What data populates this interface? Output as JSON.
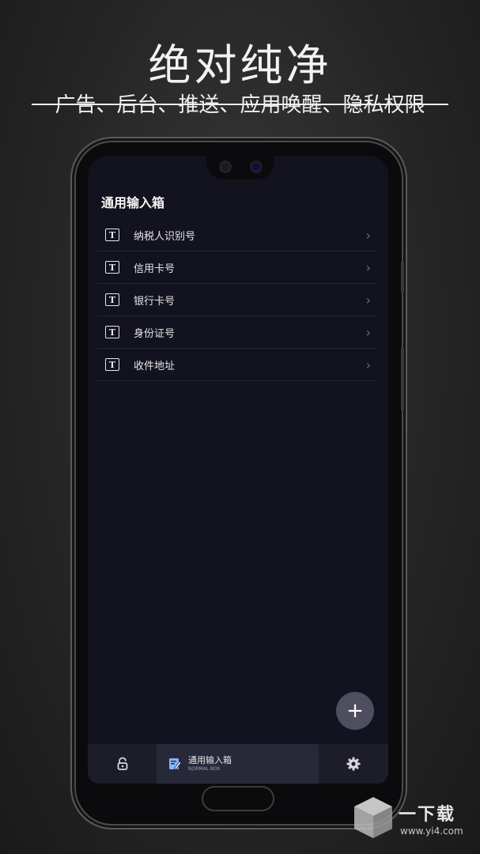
{
  "headline": "绝对纯净",
  "subline": "广告、后台、推送、应用唤醒、隐私权限",
  "screen": {
    "title": "通用输入箱",
    "items": [
      {
        "label": "纳税人识别号",
        "icon": "text-type-icon"
      },
      {
        "label": "信用卡号",
        "icon": "text-type-icon"
      },
      {
        "label": "银行卡号",
        "icon": "text-type-icon"
      },
      {
        "label": "身份证号",
        "icon": "text-type-icon"
      },
      {
        "label": "收件地址",
        "icon": "text-type-icon"
      }
    ],
    "fab_label": "+",
    "nav": {
      "left_icon": "lock-icon",
      "mid_title": "通用输入箱",
      "mid_subtitle": "NORMAL BOX",
      "mid_icon": "edit-note-icon",
      "right_icon": "gear-icon"
    }
  },
  "watermark": {
    "title": "一下载",
    "url": "www.yi4.com"
  },
  "colors": {
    "screen_bg": "#12131e",
    "nav_bg": "#1c1d29",
    "nav_active": "#272838",
    "accent_icon": "#8ab4f8",
    "fab": "#4e4e5e"
  }
}
